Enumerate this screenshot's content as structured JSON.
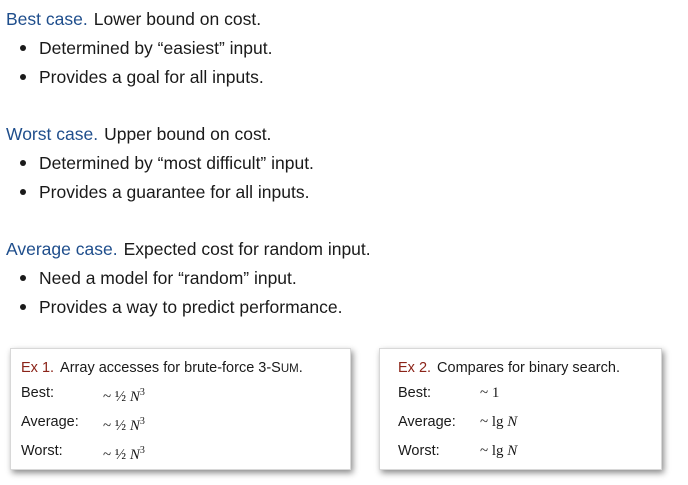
{
  "sections": [
    {
      "title": "Best case.",
      "description": "Lower bound on cost.",
      "bullets": [
        "Determined by “easiest” input.",
        "Provides a goal for all inputs."
      ]
    },
    {
      "title": "Worst case.",
      "description": "Upper bound on cost.",
      "bullets": [
        "Determined by “most difficult” input.",
        "Provides a guarantee for all inputs."
      ]
    },
    {
      "title": "Average case.",
      "description": "Expected cost for random input.",
      "bullets": [
        "Need a model for “random” input.",
        "Provides a way to predict performance."
      ]
    }
  ],
  "examples": [
    {
      "label": "Ex 1.",
      "description_prefix": "Array accesses for brute-force 3-S",
      "description_smallcaps": "UM",
      "description_suffix": ".",
      "rows": [
        {
          "label": "Best:",
          "tilde": "~",
          "half": "½",
          "var": "N",
          "exp": "3"
        },
        {
          "label": "Average:",
          "tilde": "~",
          "half": "½",
          "var": "N",
          "exp": "3"
        },
        {
          "label": "Worst:",
          "tilde": "~",
          "half": "½",
          "var": "N",
          "exp": "3"
        }
      ]
    },
    {
      "label": "Ex 2.",
      "description_prefix": "Compares for binary search.",
      "rows": [
        {
          "label": "Best:",
          "value": "~ 1"
        },
        {
          "label": "Average:",
          "value_prefix": "~ lg",
          "var": "N"
        },
        {
          "label": "Worst:",
          "value_prefix": "~ lg",
          "var": "N"
        }
      ]
    }
  ]
}
